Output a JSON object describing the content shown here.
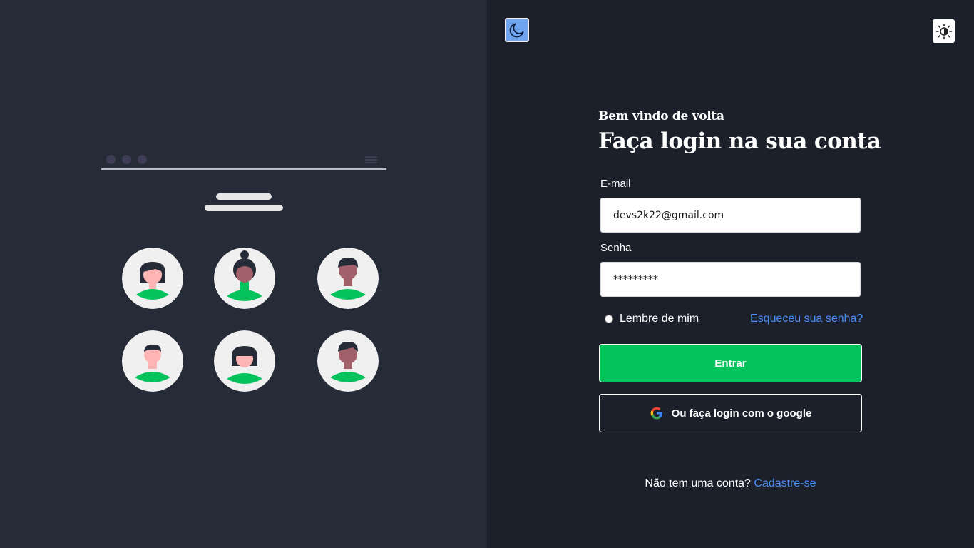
{
  "theme": {
    "dark_mode_icon": "moon-icon",
    "light_mode_icon": "sun-icon"
  },
  "illustration": {
    "avatars": [
      "person-1",
      "person-2",
      "person-3",
      "person-4",
      "person-5",
      "person-6"
    ],
    "accent_color": "#04c35c"
  },
  "login": {
    "welcome": "Bem vindo de volta",
    "title": "Faça login na sua conta",
    "email_label": "E-mail",
    "email_value": "devs2k22@gmail.com",
    "password_label": "Senha",
    "password_value": "*********",
    "remember_label": "Lembre de mim",
    "forgot_link": "Esqueceu sua senha?",
    "submit_label": "Entrar",
    "google_label": "Ou faça login com o google",
    "signup_prompt": "Não tem uma conta?",
    "signup_link": "Cadastre-se"
  },
  "colors": {
    "primary": "#04c35c",
    "link": "#4a8ff7",
    "background": "#1c202b",
    "panel": "#262b38"
  }
}
